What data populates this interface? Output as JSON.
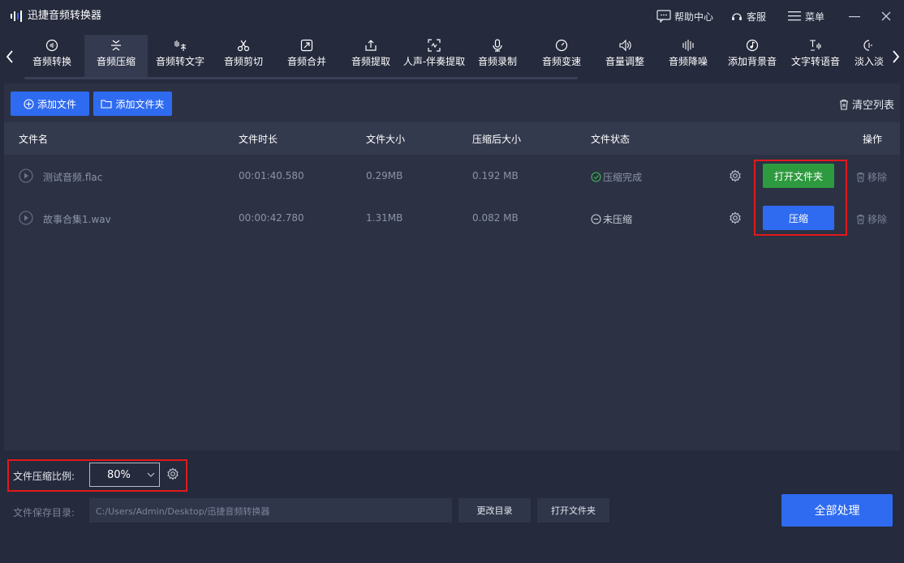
{
  "app": {
    "title": "迅捷音频转换器"
  },
  "titlebar": {
    "help": "帮助中心",
    "service": "客服",
    "menu": "菜单"
  },
  "toolbar": {
    "items": [
      {
        "label": "音频转换",
        "icon": "audio-convert-icon"
      },
      {
        "label": "音频压缩",
        "icon": "audio-compress-icon",
        "active": true
      },
      {
        "label": "音频转文字",
        "icon": "audio-to-text-icon"
      },
      {
        "label": "音频剪切",
        "icon": "scissors-icon"
      },
      {
        "label": "音频合并",
        "icon": "merge-icon"
      },
      {
        "label": "音频提取",
        "icon": "extract-icon"
      },
      {
        "label": "人声-伴奏提取",
        "icon": "vocal-extract-icon"
      },
      {
        "label": "音频录制",
        "icon": "microphone-icon"
      },
      {
        "label": "音频变速",
        "icon": "speed-icon"
      },
      {
        "label": "音量调整",
        "icon": "volume-icon"
      },
      {
        "label": "音频降噪",
        "icon": "denoise-icon"
      },
      {
        "label": "添加背景音",
        "icon": "background-music-icon"
      },
      {
        "label": "文字转语音",
        "icon": "text-to-speech-icon"
      },
      {
        "label": "淡入淡",
        "icon": "fade-icon"
      }
    ]
  },
  "actions": {
    "add_file": "添加文件",
    "add_folder": "添加文件夹",
    "clear_list": "清空列表"
  },
  "table": {
    "headers": {
      "name": "文件名",
      "duration": "文件时长",
      "size": "文件大小",
      "compressed_size": "压缩后大小",
      "status": "文件状态",
      "ops": "操作"
    },
    "rows": [
      {
        "name": "测试音频.flac",
        "duration": "00:01:40.580",
        "size": "0.29MB",
        "compressed_size": "0.192 MB",
        "status": "压缩完成",
        "action": "打开文件夹",
        "remove": "移除"
      },
      {
        "name": "故事合集1.wav",
        "duration": "00:00:42.780",
        "size": "1.31MB",
        "compressed_size": "0.082 MB",
        "status": "未压缩",
        "action": "压缩",
        "remove": "移除"
      }
    ]
  },
  "bottom": {
    "ratio_label": "文件压缩比例:",
    "ratio_value": "80%",
    "save_label": "文件保存目录:",
    "save_path": "C:/Users/Admin/Desktop/迅捷音频转换器",
    "change_dir": "更改目录",
    "open_folder": "打开文件夹",
    "process_all": "全部处理"
  },
  "colors": {
    "accent": "#2f6bf0",
    "success": "#2e9a3f",
    "highlight": "#e3191b"
  }
}
